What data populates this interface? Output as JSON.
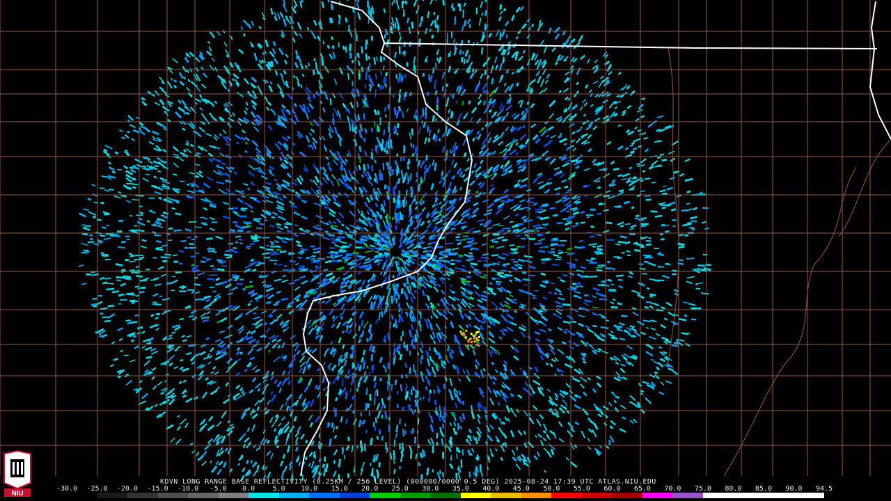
{
  "caption": "KDVN LONG RANGE BASE REFLECTIVITY (0.25KM / 256 LEVEL) (000000/0000 0.5 DEG) 2025-08-24 17:39 UTC  ATLAS.NIU.EDU",
  "logo_text": "NIU",
  "legend": {
    "ticks": [
      "-30.0",
      "-25.0",
      "-20.0",
      "-15.0",
      "-10.0",
      "-5.0",
      "0.0",
      "5.0",
      "10.0",
      "15.0",
      "20.0",
      "25.0",
      "30.0",
      "35.0",
      "40.0",
      "45.0",
      "50.0",
      "55.0",
      "60.0",
      "65.0",
      "70.0",
      "75.0",
      "80.0",
      "85.0",
      "90.0",
      "94.5"
    ],
    "colors": [
      "#000000",
      "#1a1a1a",
      "#333333",
      "#4d4d4d",
      "#666666",
      "#808080",
      "#00e5e5",
      "#00b2f0",
      "#0070ff",
      "#0040e0",
      "#00d000",
      "#00a000",
      "#007000",
      "#ffff00",
      "#e8c000",
      "#ff9000",
      "#ff0000",
      "#d00000",
      "#a00000",
      "#ff00ff",
      "#9955cc",
      "#ffffff",
      "#ffffff",
      "#ffffff",
      "#ffffff"
    ]
  },
  "map_colors": {
    "state_border": "#ffffff",
    "county_border": "#9a5a3a",
    "background": "#000000"
  }
}
